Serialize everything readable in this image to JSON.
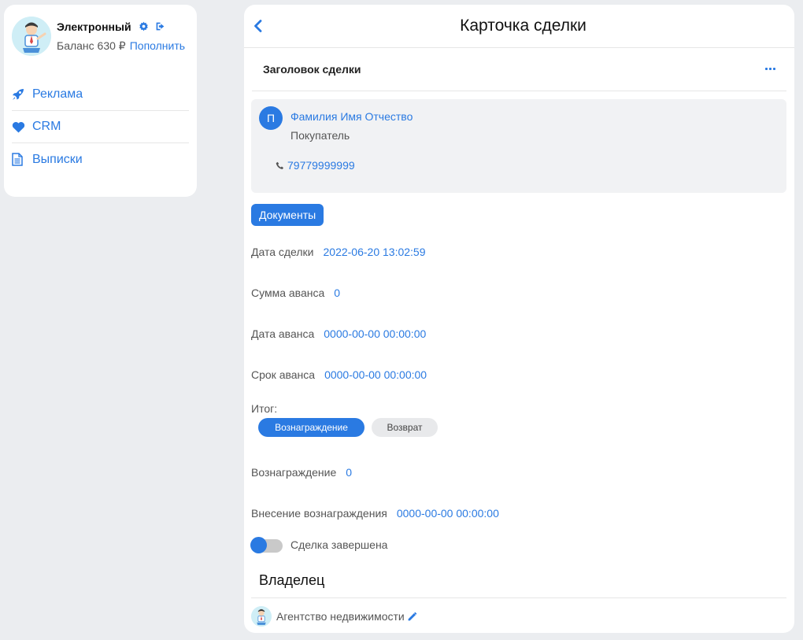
{
  "account": {
    "name": "Электронный",
    "balance_label": "Баланс 630 ₽",
    "topup_label": "Пополнить"
  },
  "menu": [
    {
      "label": "Реклама",
      "icon": "rocket-icon"
    },
    {
      "label": "CRM",
      "icon": "heart-icon"
    },
    {
      "label": "Выписки",
      "icon": "document-icon"
    }
  ],
  "card": {
    "title": "Карточка сделки",
    "deal_header": "Заголовок сделки"
  },
  "client": {
    "initial": "П",
    "name": "Фамилия Имя Отчество",
    "role": "Покупатель",
    "phone": "79779999999"
  },
  "documents_button": "Документы",
  "fields": {
    "deal_date": {
      "label": "Дата сделки",
      "value": "2022-06-20 13:02:59"
    },
    "advance_sum": {
      "label": "Сумма аванса",
      "value": "0"
    },
    "advance_date": {
      "label": "Дата аванса",
      "value": "0000-00-00 00:00:00"
    },
    "advance_term": {
      "label": "Срок аванса",
      "value": "0000-00-00 00:00:00"
    },
    "reward": {
      "label": "Вознаграждение",
      "value": "0"
    },
    "reward_payment": {
      "label": "Внесение вознаграждения",
      "value": "0000-00-00 00:00:00"
    }
  },
  "result": {
    "label": "Итог:",
    "options": [
      "Вознаграждение",
      "Возврат"
    ],
    "selected": "Вознаграждение"
  },
  "completed_toggle": {
    "label": "Сделка завершена",
    "on": false
  },
  "owner": {
    "title": "Владелец",
    "name": "Агентство недвижимости"
  },
  "colors": {
    "accent": "#2a7ae2",
    "background": "#ebedf0"
  }
}
